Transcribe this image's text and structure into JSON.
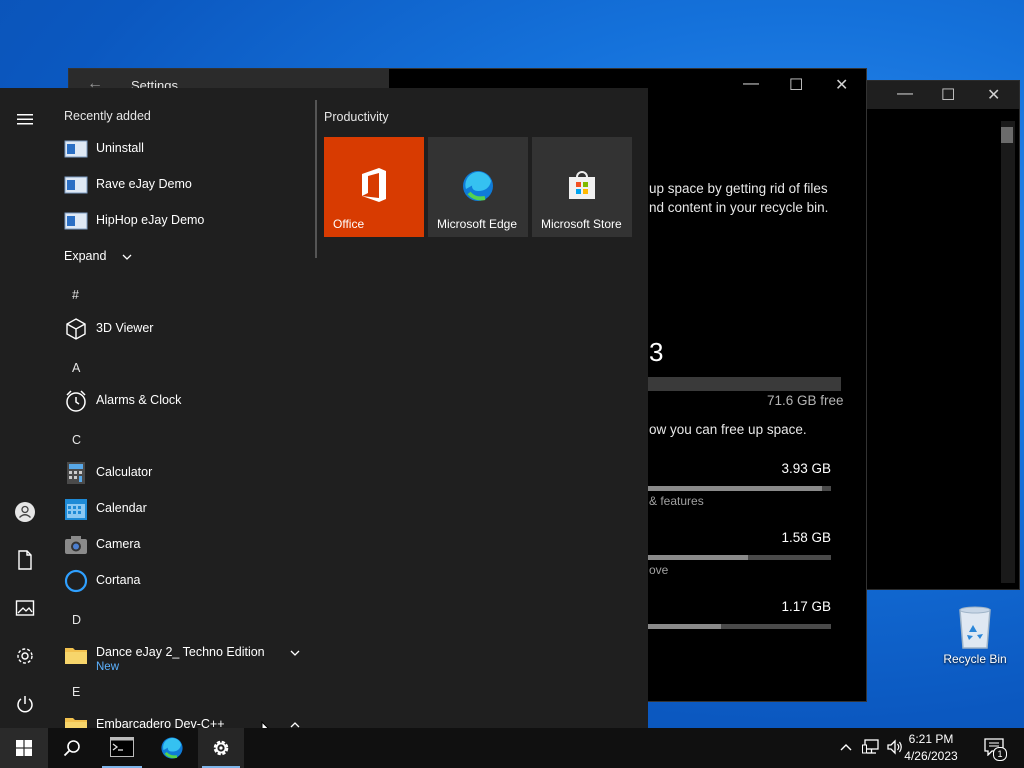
{
  "back_window": {
    "minimize": "—",
    "maximize": "☐",
    "close": "✕"
  },
  "settings": {
    "title": "Settings",
    "back_glyph": "←",
    "minimize": "—",
    "maximize": "☐",
    "close": "✕",
    "text_line1": "up space by getting rid of files",
    "text_line2": "nd content in your recycle bin.",
    "storage_partial": "3",
    "free": "71.6 GB free",
    "free_up_text": "ow you can free up space.",
    "rows": [
      {
        "value": "3.93 GB",
        "sub": "& features",
        "fill": 0.95
      },
      {
        "value": "1.58 GB",
        "sub": "ove",
        "fill": 0.55
      },
      {
        "value": "1.17 GB",
        "sub": "",
        "fill": 0.4
      }
    ]
  },
  "start_menu": {
    "recently_added_title": "Recently added",
    "recent": [
      {
        "label": "Uninstall"
      },
      {
        "label": "Rave eJay Demo"
      },
      {
        "label": "HipHop eJay Demo"
      }
    ],
    "expand_label": "Expand",
    "letters": {
      "hash": "#",
      "a": "A",
      "c": "C",
      "d": "D",
      "e": "E"
    },
    "apps": {
      "viewer": "3D Viewer",
      "alarms": "Alarms & Clock",
      "calculator": "Calculator",
      "calendar": "Calendar",
      "camera": "Camera",
      "cortana": "Cortana",
      "dance": "Dance eJay 2_ Techno Edition",
      "dance_new": "New",
      "embarcadero": "Embarcadero Dev-C++"
    },
    "tiles_group": "Productivity",
    "tiles": [
      {
        "label": "Office",
        "color": "#d83b01"
      },
      {
        "label": "Microsoft Edge",
        "color": "#333333"
      },
      {
        "label": "Microsoft Store",
        "color": "#333333"
      }
    ]
  },
  "taskbar": {
    "time": "6:21 PM",
    "date": "4/26/2023",
    "notification_count": "1"
  },
  "desktop": {
    "recycle_bin": "Recycle Bin"
  }
}
